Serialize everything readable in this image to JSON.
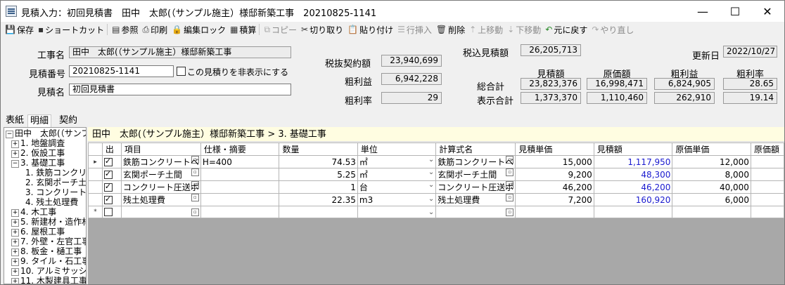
{
  "window": {
    "title": "見積入力：初回見積書　田中　太郎(（サンプル施主）様邸新築工事　20210825-1141"
  },
  "toolbar": {
    "save": "保存",
    "shortcut": "ショートカット",
    "reference": "参照",
    "print": "印刷",
    "edit_lock": "編集ロック",
    "estimate": "積算",
    "copy": "コピー",
    "cut": "切り取り",
    "paste": "貼り付け",
    "insert_row": "行挿入",
    "delete": "削除",
    "move_up": "上移動",
    "move_down": "下移動",
    "undo": "元に戻す",
    "redo": "やり直し"
  },
  "form": {
    "project_label": "工事名",
    "project_value": "田中　太郎(（サンプル施主）様邸新築工事",
    "estimate_no_label": "見積番号",
    "estimate_no_value": "20210825-1141",
    "hide_label": "この見積りを非表示にする",
    "estimate_name_label": "見積名",
    "estimate_name_value": "初回見積書",
    "contract_ex_tax_label": "税抜契約額",
    "contract_ex_tax_value": "23,940,699",
    "gross_profit_label": "粗利益",
    "gross_profit_value": "6,942,228",
    "gross_rate_label": "粗利率",
    "gross_rate_value": "29",
    "tax_incl_label": "税込見積額",
    "tax_incl_value": "26,205,713",
    "updated_label": "更新日",
    "updated_value": "2022/10/27"
  },
  "summary": {
    "headers": [
      "見積額",
      "原価額",
      "粗利益",
      "粗利率"
    ],
    "total_label": "総合計",
    "total": [
      "23,823,376",
      "16,998,471",
      "6,824,905",
      "28.65"
    ],
    "display_label": "表示合計",
    "display": [
      "1,373,370",
      "1,110,460",
      "262,910",
      "19.14"
    ]
  },
  "tabs": [
    "表紙",
    "明細",
    "契約"
  ],
  "tree": {
    "root": "田中　太郎(（サンプル",
    "items": [
      {
        "label": "1. 地盤調査",
        "pm": "+",
        "level": 1
      },
      {
        "label": "2. 仮設工事",
        "pm": "+",
        "level": 1
      },
      {
        "label": "3. 基礎工事",
        "pm": "−",
        "level": 1
      },
      {
        "label": "1. 鉄筋コンクリー",
        "pm": "",
        "level": 2
      },
      {
        "label": "2. 玄関ポーチ土",
        "pm": "",
        "level": 2
      },
      {
        "label": "3. コンクリート圧",
        "pm": "",
        "level": 2
      },
      {
        "label": "4. 残土処理費",
        "pm": "",
        "level": 2
      },
      {
        "label": "4. 木工事",
        "pm": "+",
        "level": 1
      },
      {
        "label": "5. 新建材・造作材",
        "pm": "+",
        "level": 1
      },
      {
        "label": "6. 屋根工事",
        "pm": "+",
        "level": 1
      },
      {
        "label": "7. 外壁・左官工事",
        "pm": "+",
        "level": 1
      },
      {
        "label": "8. 板金・樋工事",
        "pm": "+",
        "level": 1
      },
      {
        "label": "9. タイル・石工事",
        "pm": "+",
        "level": 1
      },
      {
        "label": "10. アルミサッシ工",
        "pm": "+",
        "level": 1
      },
      {
        "label": "11. 木製建具工事",
        "pm": "+",
        "level": 1
      }
    ]
  },
  "breadcrumb": "田中　太郎(（サンプル施主）様邸新築工事 > 3. 基礎工事",
  "grid": {
    "columns": [
      "出",
      "項目",
      "仕様・摘要",
      "数量",
      "単位",
      "計算式名",
      "見積単価",
      "見積額",
      "原価単価",
      "原価額"
    ],
    "rows": [
      {
        "out": true,
        "item": "鉄筋コンクリートベ",
        "spec": "H=400",
        "qty": "74.53",
        "unit": "㎡",
        "formula": "鉄筋コンクリートベ",
        "unit_price": "15,000",
        "amount": "1,117,950",
        "cost_unit": "12,000"
      },
      {
        "out": true,
        "item": "玄関ポーチ土間",
        "spec": "",
        "qty": "5.25",
        "unit": "㎡",
        "formula": "玄関ポーチ土間",
        "unit_price": "9,200",
        "amount": "48,300",
        "cost_unit": "8,000"
      },
      {
        "out": true,
        "item": "コンクリート圧送ポ",
        "spec": "",
        "qty": "1",
        "unit": "台",
        "formula": "コンクリート圧送ポ",
        "unit_price": "46,200",
        "amount": "46,200",
        "cost_unit": "40,000"
      },
      {
        "out": true,
        "item": "残土処理費",
        "spec": "",
        "qty": "22.35",
        "unit": "m3",
        "formula": "残土処理費",
        "unit_price": "7,200",
        "amount": "160,920",
        "cost_unit": "6,000"
      }
    ]
  }
}
